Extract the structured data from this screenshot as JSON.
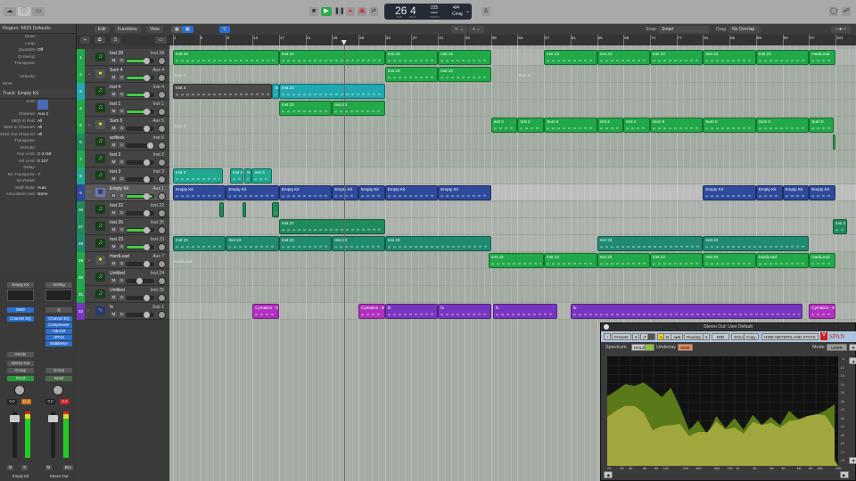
{
  "transport": {
    "bar": "26",
    "beat": "4",
    "tempo": "225",
    "tempo_label": "KEEP",
    "time_sig": "4/4",
    "key": "Cmaj",
    "bar_label": "BAR",
    "beat_label": "BEAT",
    "tempo_sub": "TEMPO"
  },
  "toolbar": {
    "edit": "Edit",
    "functions": "Functions",
    "view": "View",
    "snap_label": "Snap:",
    "snap_value": "Smart",
    "drag_label": "Drag:",
    "drag_value": "No Overlap"
  },
  "inspector": {
    "region_header": "Region: MIDI Defaults",
    "region_fields": [
      {
        "k": "Mute:",
        "v": ""
      },
      {
        "k": "Loop:",
        "v": ""
      },
      {
        "k": "Quantize",
        "v": "Off"
      },
      {
        "k": "Q-Swing:",
        "v": ""
      },
      {
        "k": "Transpose:",
        "v": ""
      },
      {
        "k": "",
        "v": ""
      },
      {
        "k": "Velocity:",
        "v": ""
      }
    ],
    "more": "More",
    "track_header": "Track: Empty Kit",
    "track_fields": [
      {
        "k": "Icon:",
        "v": ""
      },
      {
        "k": "Channel:",
        "v": "Aux 1"
      },
      {
        "k": "MIDI In Port:",
        "v": "All"
      },
      {
        "k": "MIDI In Channel:",
        "v": "All"
      },
      {
        "k": "MIDI Out Channel:",
        "v": "All"
      },
      {
        "k": "Transpose:",
        "v": ""
      },
      {
        "k": "Velocity:",
        "v": ""
      },
      {
        "k": "Key Limit:",
        "v": "C-2  G8"
      },
      {
        "k": "Vel Limit:",
        "v": "0  127"
      },
      {
        "k": "Delay:",
        "v": ""
      },
      {
        "k": "No Transpose:",
        "v": "✓"
      },
      {
        "k": "No Reset:",
        "v": ""
      },
      {
        "k": "Staff Style:",
        "v": "Auto"
      },
      {
        "k": "Articulation Set:",
        "v": "None"
      }
    ]
  },
  "mixer": {
    "strips": [
      {
        "name": "Empty Kit",
        "setting": "Empty Kit",
        "input": "DMD",
        "plugins": [
          "Channel EQ"
        ],
        "sends": "Sends",
        "output": "Stereo Out",
        "group": "Group",
        "automation": "Read",
        "volume": "0.0",
        "peak": "11.6",
        "m": "M",
        "s": "S"
      },
      {
        "name": "Stereo Out",
        "setting": "Setting",
        "input": "◎",
        "plugins": [
          "Channel EQ",
          "Compressor",
          "AdLimit",
          "SPAN",
          "MultiMeter"
        ],
        "sends": "",
        "output": "",
        "group": "Group",
        "automation": "Read",
        "volume": "0.0",
        "peak": "0.0",
        "m": "M",
        "s": "Bnc"
      }
    ]
  },
  "colors": {
    "green": "#21a849",
    "teal": "#1fa8b0",
    "darkgreen": "#1f8a5a",
    "blue": "#2e4a9a",
    "purple": "#7a35c0",
    "magenta": "#b030c0",
    "grey": "#4a4a4a"
  },
  "tracks": [
    {
      "num": "1",
      "name": "Inst 28",
      "out": "Inst 28",
      "color": "#21a849",
      "icon": "instrument",
      "level": 0.8
    },
    {
      "num": "2",
      "name": "Sum 4",
      "out": "Aux 4",
      "color": "#21a849",
      "icon": "folder",
      "level": 0.9
    },
    {
      "num": "3",
      "name": "Inst 4",
      "out": "Inst 4",
      "color": "#1fa8b0",
      "icon": "instrument",
      "level": 0.8
    },
    {
      "num": "4",
      "name": "Inst 1",
      "out": "Inst 1",
      "color": "#21a849",
      "icon": "instrument",
      "level": 0.9
    },
    {
      "num": "5",
      "name": "Sum 5",
      "out": "Aux 5",
      "color": "#21a849",
      "icon": "folder",
      "level": 0
    },
    {
      "num": "6",
      "name": "softkick",
      "out": "Inst 5",
      "color": "#1f8a5a",
      "icon": "instrument",
      "level": 0
    },
    {
      "num": "7",
      "name": "Inst 2",
      "out": "Inst 2",
      "color": "#21a849",
      "icon": "instrument",
      "level": 0
    },
    {
      "num": "8",
      "name": "Inst 3",
      "out": "Inst 3",
      "color": "#1fa890",
      "icon": "instrument",
      "level": 0
    },
    {
      "num": "9",
      "name": "Empty Kit",
      "out": "Aux 1",
      "color": "#2e4a9a",
      "icon": "drum-kit",
      "level": 0.95
    },
    {
      "num": "26",
      "name": "Inst 22",
      "out": "Inst 22",
      "color": "#1f8a5a",
      "icon": "instrument",
      "level": 0
    },
    {
      "num": "27",
      "name": "Inst 26",
      "out": "Inst 26",
      "color": "#1f8a5a",
      "icon": "instrument",
      "level": 0.9
    },
    {
      "num": "28",
      "name": "Inst 23",
      "out": "Inst 23",
      "color": "#1f8a70",
      "icon": "instrument",
      "level": 0.8
    },
    {
      "num": "29",
      "name": "HardLead",
      "out": "Aux 7",
      "color": "#21a849",
      "icon": "folder",
      "level": 0
    },
    {
      "num": "30",
      "name": "Untitled",
      "out": "Inst 24",
      "color": "#21a849",
      "icon": "instrument",
      "level": 0
    },
    {
      "num": "31",
      "name": "Untitled",
      "out": "Inst 25",
      "color": "#21a849",
      "icon": "instrument",
      "level": 0
    },
    {
      "num": "32",
      "name": "fx",
      "out": "Sub 1",
      "color": "#7a35c0",
      "icon": "audio",
      "level": 0
    }
  ],
  "ruler": {
    "bars": [
      "1",
      "5",
      "9",
      "13",
      "17",
      "21",
      "25",
      "29",
      "33",
      "37",
      "41",
      "45",
      "49",
      "53",
      "57",
      "61",
      "65",
      "69",
      "73",
      "77",
      "81",
      "85",
      "89",
      "93",
      "97",
      "101"
    ],
    "playhead_bar": 26.8
  },
  "folder_labels": [
    {
      "lane": 1,
      "bar": 1,
      "text": "Sum 4"
    },
    {
      "lane": 1,
      "bar": 53,
      "text": "Sum 4"
    },
    {
      "lane": 4,
      "bar": 1,
      "text": "Sum 5"
    },
    {
      "lane": 12,
      "bar": 1,
      "text": "HardLead"
    }
  ],
  "regions": [
    {
      "lane": 0,
      "s": 1,
      "e": 17,
      "name": "Inst 28",
      "c": "#21a849"
    },
    {
      "lane": 0,
      "s": 17,
      "e": 33,
      "name": "Inst 23",
      "c": "#21a849"
    },
    {
      "lane": 0,
      "s": 33,
      "e": 41,
      "name": "Inst 23",
      "c": "#21a849"
    },
    {
      "lane": 0,
      "s": 41,
      "e": 49,
      "name": "Inst 23",
      "c": "#21a849"
    },
    {
      "lane": 0,
      "s": 57,
      "e": 65,
      "name": "Inst 23",
      "c": "#21a849"
    },
    {
      "lane": 0,
      "s": 65,
      "e": 73,
      "name": "Inst 23",
      "c": "#21a849"
    },
    {
      "lane": 0,
      "s": 73,
      "e": 81,
      "name": "Inst 23",
      "c": "#21a849"
    },
    {
      "lane": 0,
      "s": 81,
      "e": 89,
      "name": "Inst 23",
      "c": "#21a849"
    },
    {
      "lane": 0,
      "s": 89,
      "e": 97,
      "name": "Inst 23",
      "c": "#21a849"
    },
    {
      "lane": 0,
      "s": 97,
      "e": 101,
      "name": "HardLead",
      "c": "#21a849"
    },
    {
      "lane": 1,
      "s": 33,
      "e": 41,
      "name": "Inst 23",
      "c": "#21a849"
    },
    {
      "lane": 1,
      "s": 41,
      "e": 49,
      "name": "Inst 23",
      "c": "#21a849"
    },
    {
      "lane": 2,
      "s": 1,
      "e": 16,
      "name": "Inst 4",
      "c": "#4a4a4a"
    },
    {
      "lane": 2,
      "s": 16,
      "e": 17,
      "name": "In",
      "c": "#1fa8b0"
    },
    {
      "lane": 2,
      "s": 17,
      "e": 33,
      "name": "Inst 23",
      "c": "#1fa8b0"
    },
    {
      "lane": 3,
      "s": 17,
      "e": 25,
      "name": "Inst 23",
      "c": "#21a849"
    },
    {
      "lane": 3,
      "s": 25,
      "e": 33,
      "name": "Inst 23",
      "c": "#21a849"
    },
    {
      "lane": 4,
      "s": 49,
      "e": 53,
      "name": "Inst 2",
      "c": "#21a849"
    },
    {
      "lane": 4,
      "s": 53,
      "e": 57,
      "name": "Inst 2",
      "c": "#21a849"
    },
    {
      "lane": 4,
      "s": 57,
      "e": 65,
      "name": "Sum 5",
      "c": "#21a849"
    },
    {
      "lane": 4,
      "s": 65,
      "e": 69,
      "name": "Inst 2",
      "c": "#21a849"
    },
    {
      "lane": 4,
      "s": 69,
      "e": 73,
      "name": "Inst 2",
      "c": "#21a849"
    },
    {
      "lane": 4,
      "s": 73,
      "e": 81,
      "name": "Sum 5",
      "c": "#21a849"
    },
    {
      "lane": 4,
      "s": 81,
      "e": 89,
      "name": "Sum 5",
      "c": "#21a849"
    },
    {
      "lane": 4,
      "s": 89,
      "e": 97,
      "name": "Sum 5",
      "c": "#21a849"
    },
    {
      "lane": 4,
      "s": 97,
      "e": 100.7,
      "name": "Sum 5",
      "c": "#21a849"
    },
    {
      "lane": 5,
      "s": 100.6,
      "e": 101,
      "name": "",
      "c": "#21a849"
    },
    {
      "lane": 7,
      "s": 1,
      "e": 8.5,
      "name": "Inst 3",
      "c": "#1fa890"
    },
    {
      "lane": 7,
      "s": 9.6,
      "e": 11.6,
      "name": "Inst 3",
      "c": "#1fa890"
    },
    {
      "lane": 7,
      "s": 11.8,
      "e": 12.8,
      "name": "In",
      "c": "#1fa890"
    },
    {
      "lane": 7,
      "s": 12.9,
      "e": 16,
      "name": "Inst 3",
      "c": "#1fa890"
    },
    {
      "lane": 8,
      "s": 1,
      "e": 9,
      "name": "Empty Kit",
      "c": "#2e4a9a"
    },
    {
      "lane": 8,
      "s": 9,
      "e": 17,
      "name": "Empty Kit",
      "c": "#2e4a9a"
    },
    {
      "lane": 8,
      "s": 17,
      "e": 25,
      "name": "Empty Kit",
      "c": "#2e4a9a"
    },
    {
      "lane": 8,
      "s": 25,
      "e": 29,
      "name": "Empty Kit",
      "c": "#2e4a9a"
    },
    {
      "lane": 8,
      "s": 29,
      "e": 33,
      "name": "Empty Kit",
      "c": "#2e4a9a"
    },
    {
      "lane": 8,
      "s": 33,
      "e": 41,
      "name": "Empty Kit",
      "c": "#2e4a9a"
    },
    {
      "lane": 8,
      "s": 41,
      "e": 49,
      "name": "Empty Kit",
      "c": "#2e4a9a"
    },
    {
      "lane": 8,
      "s": 81,
      "e": 89,
      "name": "Empty Kit",
      "c": "#2e4a9a"
    },
    {
      "lane": 8,
      "s": 89,
      "e": 93,
      "name": "Empty Kit",
      "c": "#2e4a9a"
    },
    {
      "lane": 8,
      "s": 93,
      "e": 97,
      "name": "Empty Kit",
      "c": "#2e4a9a"
    },
    {
      "lane": 8,
      "s": 97,
      "e": 101,
      "name": "Empty Kit",
      "c": "#2e4a9a"
    },
    {
      "lane": 9,
      "s": 8.0,
      "e": 8.7,
      "name": "",
      "c": "#1f8a5a"
    },
    {
      "lane": 9,
      "s": 11.5,
      "e": 12,
      "name": "",
      "c": "#1f8a5a"
    },
    {
      "lane": 9,
      "s": 16,
      "e": 17,
      "name": "",
      "c": "#1f8a5a"
    },
    {
      "lane": 10,
      "s": 17,
      "e": 33,
      "name": "Inst 22",
      "c": "#1f8a5a"
    },
    {
      "lane": 10,
      "s": 100.6,
      "e": 102.8,
      "name": "Inst 2",
      "c": "#1f8a5a"
    },
    {
      "lane": 11,
      "s": 1,
      "e": 9,
      "name": "Inst 23",
      "c": "#1f8a70"
    },
    {
      "lane": 11,
      "s": 9,
      "e": 17,
      "name": "Inst 23",
      "c": "#1f8a70"
    },
    {
      "lane": 11,
      "s": 17,
      "e": 25,
      "name": "Inst 23",
      "c": "#1f8a70"
    },
    {
      "lane": 11,
      "s": 25,
      "e": 33,
      "name": "Inst 23",
      "c": "#1f8a70"
    },
    {
      "lane": 11,
      "s": 33,
      "e": 49,
      "name": "Inst 23",
      "c": "#1f8a70"
    },
    {
      "lane": 11,
      "s": 65,
      "e": 81,
      "name": "Inst 23",
      "c": "#1f8a70"
    },
    {
      "lane": 11,
      "s": 81,
      "e": 97,
      "name": "Inst 23",
      "c": "#1f8a70"
    },
    {
      "lane": 12,
      "s": 48.6,
      "e": 57,
      "name": "Inst 23",
      "c": "#21a849"
    },
    {
      "lane": 12,
      "s": 57,
      "e": 65,
      "name": "Inst 23",
      "c": "#21a849"
    },
    {
      "lane": 12,
      "s": 65,
      "e": 73,
      "name": "Inst 23",
      "c": "#21a849"
    },
    {
      "lane": 12,
      "s": 73,
      "e": 81,
      "name": "Inst 23",
      "c": "#21a849"
    },
    {
      "lane": 12,
      "s": 81,
      "e": 89,
      "name": "Inst 23",
      "c": "#21a849"
    },
    {
      "lane": 12,
      "s": 89,
      "e": 97,
      "name": "HardLead",
      "c": "#21a849"
    },
    {
      "lane": 12,
      "s": 97,
      "e": 101,
      "name": "HardLead",
      "c": "#21a849"
    },
    {
      "lane": 15,
      "s": 13,
      "e": 17,
      "name": "Cymatics - W",
      "c": "#b030c0"
    },
    {
      "lane": 15,
      "s": 29,
      "e": 33,
      "name": "Cymatics - W",
      "c": "#b030c0"
    },
    {
      "lane": 15,
      "s": 33,
      "e": 41,
      "name": "fx",
      "c": "#7a35c0"
    },
    {
      "lane": 15,
      "s": 41,
      "e": 49,
      "name": "fx",
      "c": "#7a35c0"
    },
    {
      "lane": 15,
      "s": 49.3,
      "e": 59,
      "name": "fx",
      "c": "#7a35c0"
    },
    {
      "lane": 15,
      "s": 61,
      "e": 96,
      "name": "fx",
      "c": "#7a35c0"
    },
    {
      "lane": 15,
      "s": 97,
      "e": 101,
      "name": "Cymatics - W",
      "c": "#b030c0"
    }
  ],
  "span": {
    "title": "Stereo Out: User Default",
    "presets": "Presets",
    "ab": "A",
    "b": "B",
    "atob": "A▸B",
    "routing": "Routing",
    "mid": "MID",
    "solo": "SOLO",
    "copy": "Copy",
    "hide": "HIDE METERS AND STATS",
    "brand": "SPAN",
    "spectrum": "Spectrum",
    "hold": "HOLD",
    "underlay": "Underlay",
    "side": "SIDE",
    "mode": "Mode",
    "mode_value": "USER",
    "db_ticks": [
      "6",
      "-12",
      "-18",
      "-24",
      "-30",
      "-36",
      "-42",
      "-48",
      "-54",
      "-60",
      "-66",
      "-72",
      "-78"
    ],
    "freq_ticks": [
      "20",
      "30",
      "40",
      "60",
      "80",
      "100",
      "200",
      "300",
      "500",
      "700",
      "1K",
      "2K",
      "3K",
      "4K",
      "6K",
      "8K",
      "10K",
      "20K"
    ]
  }
}
